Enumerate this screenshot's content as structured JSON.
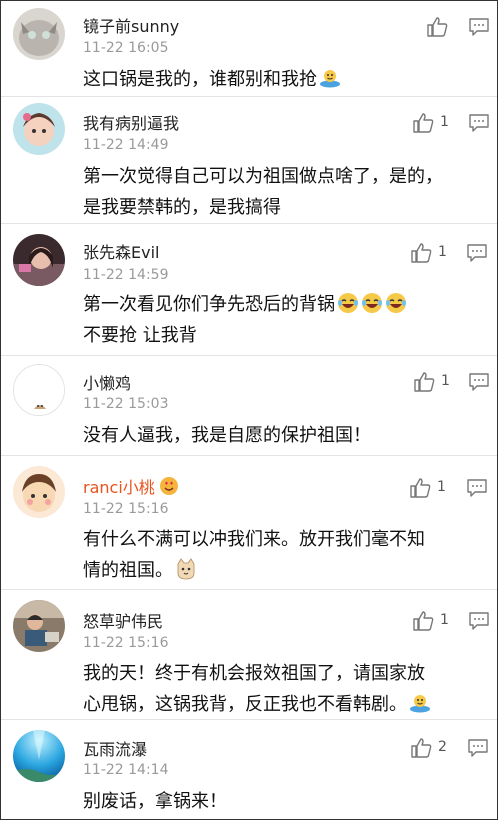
{
  "comments": [
    {
      "username": "镜子前sunny",
      "time": "11-22 16:05",
      "text": "这口锅是我的，谁都别和我抢",
      "likes": "",
      "emoji": [
        "carry-pot-emoji"
      ]
    },
    {
      "username": "我有病别逼我",
      "time": "11-22 14:49",
      "text": "第一次觉得自己可以为祖国做点啥了，是的，是我要禁韩的，是我搞得",
      "likes": "1",
      "emoji": []
    },
    {
      "username": "张先森Evil",
      "time": "11-22 14:59",
      "text_line1": "第一次看见你们争先恐后的背锅",
      "text_line2": "不要抢 让我背",
      "likes": "1",
      "emoji": [
        "laugh-cry-emoji",
        "laugh-cry-emoji",
        "laugh-cry-emoji"
      ]
    },
    {
      "username": "小懒鸡",
      "time": "11-22 15:03",
      "text": "没有人逼我，我是自愿的保护祖国！",
      "likes": "1",
      "emoji": []
    },
    {
      "username": "ranci小桃",
      "time": "11-22 15:16",
      "text_line1": "有什么不满可以冲我们来。放开我们毫不知",
      "text_line2": "情的祖国。",
      "likes": "1",
      "emoji": [
        "cat-emoji"
      ],
      "badge": "heart-eyes-badge"
    },
    {
      "username": "怒草驴伟民",
      "time": "11-22 15:16",
      "text_line1": "我的天！终于有机会报效祖国了，请国家放",
      "text_line2": "心甩锅，这锅我背，反正我也不看韩剧。",
      "likes": "1",
      "emoji": [
        "carry-pot-emoji"
      ]
    },
    {
      "username": "瓦雨流瀑",
      "time": "11-22 14:14",
      "text": "别废话，拿锅来！",
      "likes": "2",
      "emoji": []
    }
  ],
  "colors": {
    "vip_name": "#e8541e",
    "time": "#9a9a9a",
    "divider": "#e4e4e4"
  }
}
